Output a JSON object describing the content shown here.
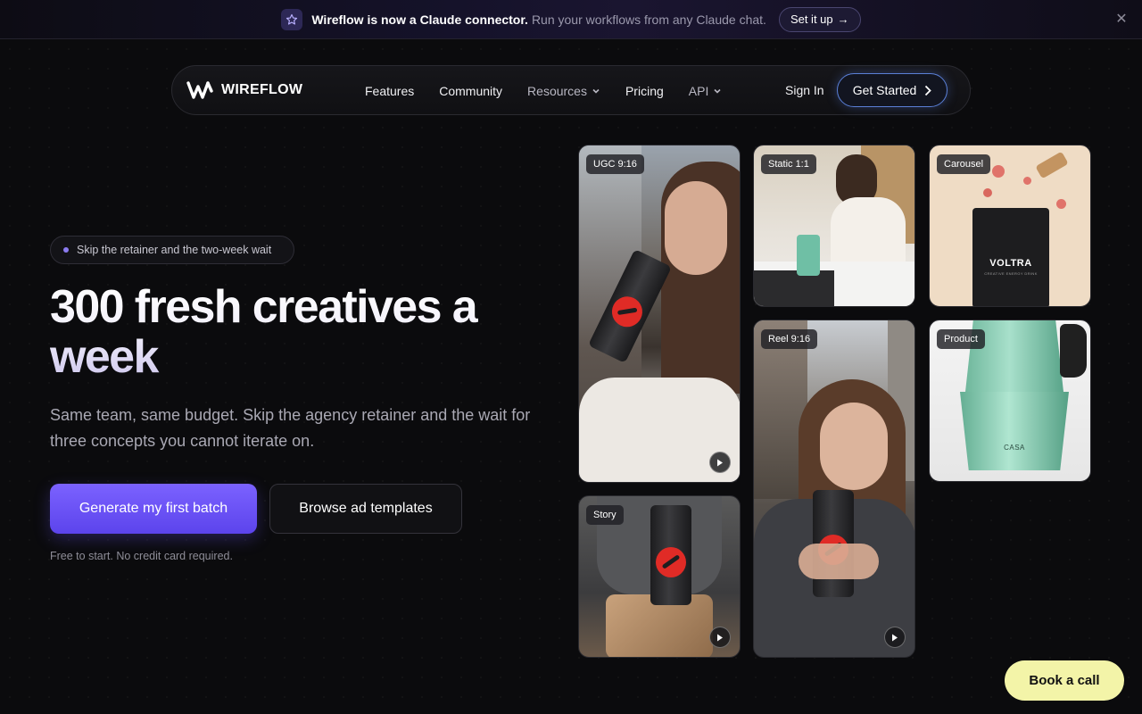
{
  "announcement": {
    "title": "Wireflow is now a Claude connector.",
    "text": "Run your workflows from any Claude chat.",
    "cta": "Set it up",
    "cta_arrow": "→",
    "close": "✕"
  },
  "nav": {
    "brand": "WIREFLOW",
    "links": [
      "Features",
      "Community",
      "Resources",
      "Pricing",
      "API"
    ],
    "sign_in": "Sign In",
    "get_started": "Get Started"
  },
  "hero": {
    "pill": "Skip the retainer and the two-week wait",
    "headline": "300 fresh creatives a week",
    "subtitle": "Same team, same budget. Skip the agency retainer and the wait for three concepts you cannot iterate on.",
    "primary_cta": "Generate my first batch",
    "secondary_cta": "Browse ad templates",
    "fine_print": "Free to start. No credit card required."
  },
  "gallery": {
    "tags": [
      "UGC 9:16",
      "Static 1:1",
      "Carousel",
      "Reel 9:16",
      "Product",
      "Story"
    ],
    "product_brand": "VOLTRA",
    "product_sub": "CREATIVE ENERGY DRINK",
    "kettle_brand": "CASA"
  },
  "book_call": "Book a call",
  "colors": {
    "accent": "#6a52f7",
    "book_call_bg": "#f3f4a8",
    "background": "#0b0b0d"
  },
  "icons": [
    "star-icon",
    "close-icon",
    "wireflow-logo-icon",
    "chevron-down-icon",
    "chevron-right-icon",
    "play-icon"
  ]
}
